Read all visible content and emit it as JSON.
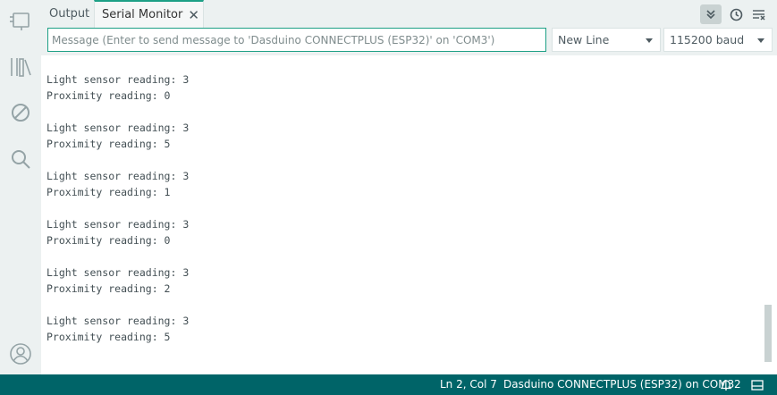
{
  "sidebar": {
    "items": [
      {
        "icon": "board-icon"
      },
      {
        "icon": "library-icon"
      },
      {
        "icon": "debug-icon"
      },
      {
        "icon": "search-icon"
      }
    ],
    "bottom_icon": "profile-icon"
  },
  "panel": {
    "tabs": [
      {
        "label": "Output"
      },
      {
        "label": "Serial Monitor"
      }
    ],
    "toolbar": {
      "autoscroll_icon": "double-chevron-down-icon",
      "timestamp_icon": "clock-icon",
      "clear_icon": "clear-output-icon"
    }
  },
  "message": {
    "placeholder": "Message (Enter to send message to 'Dasduino CONNECTPLUS (ESP32)' on 'COM3')",
    "value": ""
  },
  "line_ending": {
    "selected": "New Line"
  },
  "baud": {
    "selected": "115200 baud"
  },
  "output": {
    "blocks": [
      {
        "light": "Light sensor reading: 3",
        "proximity": "Proximity reading: 0"
      },
      {
        "light": "Light sensor reading: 3",
        "proximity": "Proximity reading: 5"
      },
      {
        "light": "Light sensor reading: 3",
        "proximity": "Proximity reading: 1"
      },
      {
        "light": "Light sensor reading: 3",
        "proximity": "Proximity reading: 0"
      },
      {
        "light": "Light sensor reading: 3",
        "proximity": "Proximity reading: 2"
      },
      {
        "light": "Light sensor reading: 3",
        "proximity": "Proximity reading: 5"
      }
    ]
  },
  "status": {
    "position": "Ln 2, Col 7",
    "board": "Dasduino CONNECTPLUS (ESP32) on COM3",
    "notifications": "2"
  },
  "colors": {
    "accent": "#1da086",
    "statusbar": "#006468",
    "sidebar": "#ecf1f1"
  }
}
